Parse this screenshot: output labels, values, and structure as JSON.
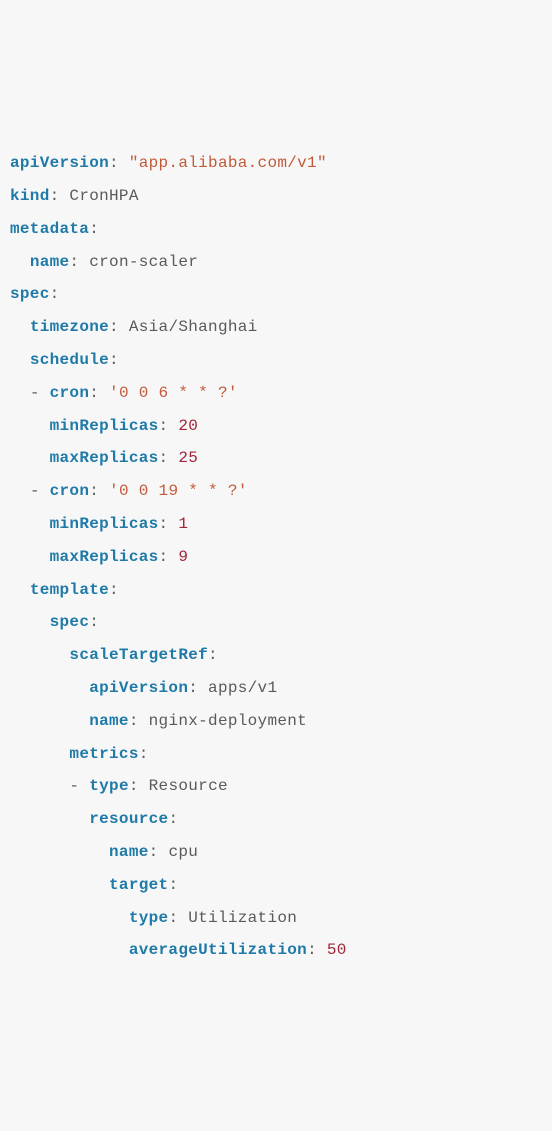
{
  "l0": {
    "k": "apiVersion",
    "c": ": ",
    "s": "\"app.alibaba.com/v1\""
  },
  "l1": {
    "k": "kind",
    "c": ": ",
    "v": "CronHPA"
  },
  "l2": {
    "k": "metadata",
    "c": ":"
  },
  "l3": {
    "i": "  ",
    "k": "name",
    "c": ": ",
    "v": "cron-scaler"
  },
  "l4": {
    "k": "spec",
    "c": ":"
  },
  "l5": {
    "i": "  ",
    "k": "timezone",
    "c": ": ",
    "v": "Asia/Shanghai"
  },
  "l6": {
    "i": "  ",
    "k": "schedule",
    "c": ":"
  },
  "l7": {
    "i": "  ",
    "d": "- ",
    "k": "cron",
    "c": ": ",
    "s": "'0 0 6 * * ?'"
  },
  "l8": {
    "i": "    ",
    "k": "minReplicas",
    "c": ": ",
    "n": "20"
  },
  "l9": {
    "i": "    ",
    "k": "maxReplicas",
    "c": ": ",
    "n": "25"
  },
  "l10": {
    "i": "  ",
    "d": "- ",
    "k": "cron",
    "c": ": ",
    "s": "'0 0 19 * * ?'"
  },
  "l11": {
    "i": "    ",
    "k": "minReplicas",
    "c": ": ",
    "n": "1"
  },
  "l12": {
    "i": "    ",
    "k": "maxReplicas",
    "c": ": ",
    "n": "9"
  },
  "l13": {
    "i": "  ",
    "k": "template",
    "c": ":"
  },
  "l14": {
    "i": "    ",
    "k": "spec",
    "c": ":"
  },
  "l15": {
    "i": "      ",
    "k": "scaleTargetRef",
    "c": ":"
  },
  "l16": {
    "i": "        ",
    "k": "apiVersion",
    "c": ": ",
    "v": "apps/v1"
  },
  "l17": {
    "i": "        ",
    "k": "name",
    "c": ": ",
    "v": "nginx-deployment"
  },
  "l18": {
    "i": "      ",
    "k": "metrics",
    "c": ":"
  },
  "l19": {
    "i": "      ",
    "d": "- ",
    "k": "type",
    "c": ": ",
    "v": "Resource"
  },
  "l20": {
    "i": "        ",
    "k": "resource",
    "c": ":"
  },
  "l21": {
    "i": "          ",
    "k": "name",
    "c": ": ",
    "v": "cpu"
  },
  "l22": {
    "i": "          ",
    "k": "target",
    "c": ":"
  },
  "l23": {
    "i": "            ",
    "k": "type",
    "c": ": ",
    "v": "Utilization"
  },
  "l24": {
    "i": "            ",
    "k": "averageUtilization",
    "c": ": ",
    "n": "50"
  }
}
